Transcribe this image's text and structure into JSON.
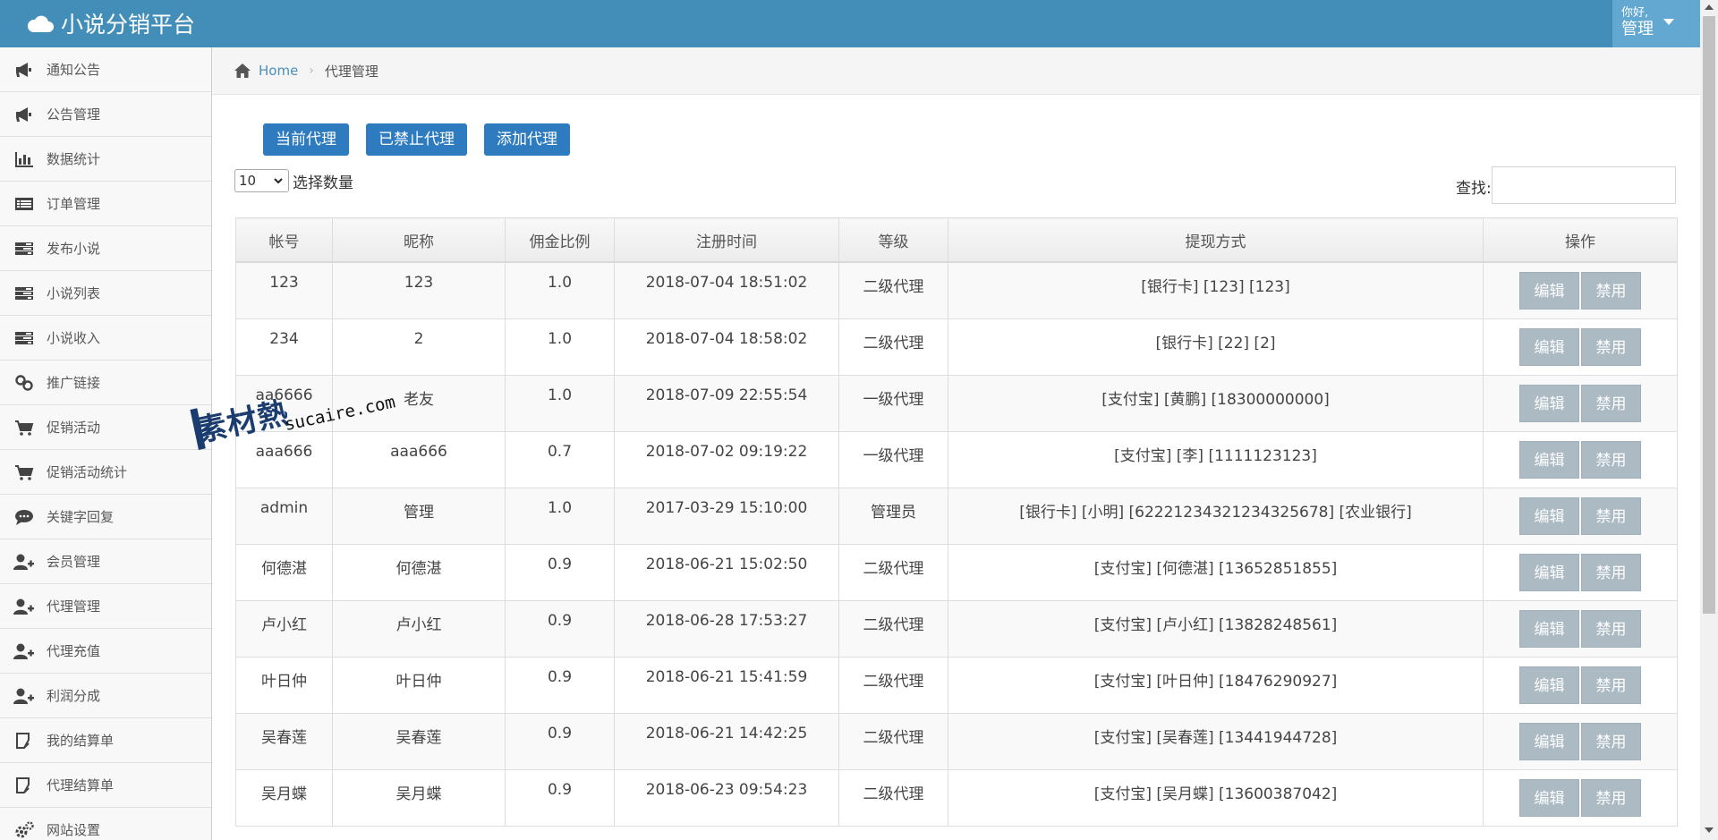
{
  "app": {
    "title": "小说分销平台"
  },
  "user": {
    "greeting": "你好,",
    "name": "管理"
  },
  "sidebar": {
    "items": [
      {
        "label": "通知公告",
        "icon": "megaphone-icon"
      },
      {
        "label": "公告管理",
        "icon": "megaphone-icon"
      },
      {
        "label": "数据统计",
        "icon": "bar-chart-icon"
      },
      {
        "label": "订单管理",
        "icon": "list-icon"
      },
      {
        "label": "发布小说",
        "icon": "tasks-icon"
      },
      {
        "label": "小说列表",
        "icon": "tasks-icon"
      },
      {
        "label": "小说收入",
        "icon": "tasks-icon"
      },
      {
        "label": "推广链接",
        "icon": "link-icon"
      },
      {
        "label": "促销活动",
        "icon": "cart-icon"
      },
      {
        "label": "促销活动统计",
        "icon": "cart-icon"
      },
      {
        "label": "关键字回复",
        "icon": "comment-icon"
      },
      {
        "label": "会员管理",
        "icon": "user-plus-icon"
      },
      {
        "label": "代理管理",
        "icon": "user-plus-icon"
      },
      {
        "label": "代理充值",
        "icon": "user-plus-icon"
      },
      {
        "label": "利润分成",
        "icon": "user-plus-icon"
      },
      {
        "label": "我的结算单",
        "icon": "edit-icon"
      },
      {
        "label": "代理结算单",
        "icon": "edit-icon"
      },
      {
        "label": "网站设置",
        "icon": "gears-icon"
      }
    ]
  },
  "breadcrumb": {
    "home": "Home",
    "current": "代理管理"
  },
  "tabs": {
    "current": "当前代理",
    "banned": "已禁止代理",
    "add": "添加代理"
  },
  "controls": {
    "page_length": "10",
    "page_length_label": "选择数量",
    "search_label": "查找:"
  },
  "table": {
    "headers": [
      "帐号",
      "昵称",
      "佣金比例",
      "注册时间",
      "等级",
      "提现方式",
      "操作"
    ],
    "edit_label": "编辑",
    "disable_label": "禁用",
    "rows": [
      [
        "123",
        "123",
        "1.0",
        "2018-07-04 18:51:02",
        "二级代理",
        "[银行卡] [123] [123]"
      ],
      [
        "234",
        "2",
        "1.0",
        "2018-07-04 18:58:02",
        "二级代理",
        "[银行卡] [22] [2]"
      ],
      [
        "aa6666",
        "老友",
        "1.0",
        "2018-07-09 22:55:54",
        "一级代理",
        "[支付宝] [黄鹏] [18300000000]"
      ],
      [
        "aaa666",
        "aaa666",
        "0.7",
        "2018-07-02 09:19:22",
        "一级代理",
        "[支付宝] [李] [1111123123]"
      ],
      [
        "admin",
        "管理",
        "1.0",
        "2017-03-29 15:10:00",
        "管理员",
        "[银行卡] [小明] [62221234321234325678]  [农业银行]"
      ],
      [
        "何德湛",
        "何德湛",
        "0.9",
        "2018-06-21 15:02:50",
        "二级代理",
        "[支付宝] [何德湛] [13652851855]"
      ],
      [
        "卢小红",
        "卢小红",
        "0.9",
        "2018-06-28 17:53:27",
        "二级代理",
        "[支付宝] [卢小红] [13828248561]"
      ],
      [
        "叶日仲",
        "叶日仲",
        "0.9",
        "2018-06-21 15:41:59",
        "二级代理",
        "[支付宝] [叶日仲] [18476290927]"
      ],
      [
        "吴春莲",
        "吴春莲",
        "0.9",
        "2018-06-21 14:42:25",
        "二级代理",
        "[支付宝] [吴春莲] [13441944728]"
      ],
      [
        "吴月蝶",
        "吴月蝶",
        "0.9",
        "2018-06-23 09:54:23",
        "二级代理",
        "[支付宝] [吴月蝶] [13600387042]"
      ]
    ]
  },
  "watermark": {
    "cn": "素材熱",
    "en": "sucaire.com"
  },
  "colors": {
    "navbar": "#438eb9",
    "primary_button": "#2f7bbf",
    "op_button": "#abbac3"
  }
}
